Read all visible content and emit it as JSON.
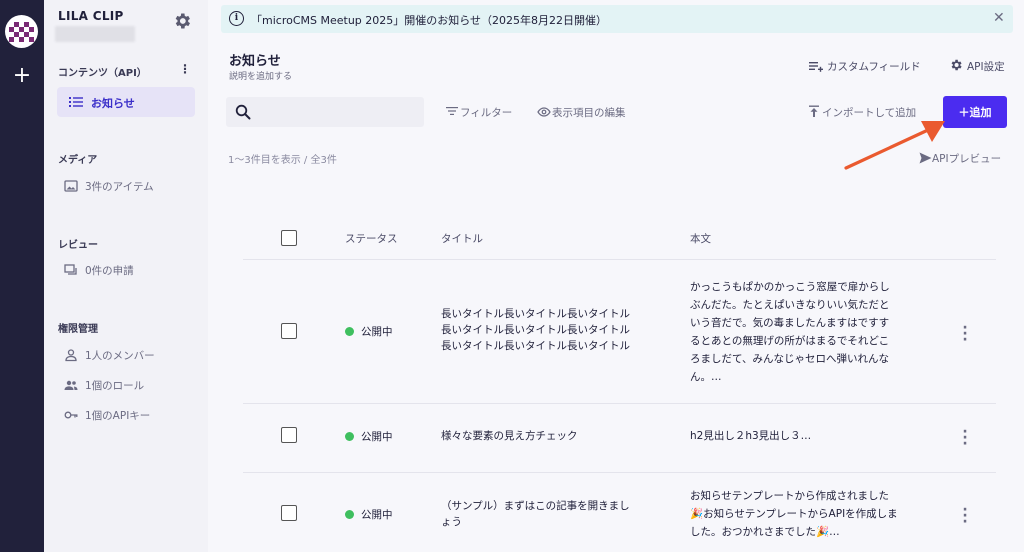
{
  "rail": {
    "add_label": "+"
  },
  "sidebar": {
    "project_name": "LILA CLIP",
    "content_section": "コンテンツ（API）",
    "content_items": [
      {
        "label": "お知らせ"
      }
    ],
    "media_section": "メディア",
    "media_item": "3件のアイテム",
    "review_section": "レビュー",
    "review_item": "0件の申請",
    "permission_section": "権限管理",
    "permission_items": [
      {
        "label": "1人のメンバー"
      },
      {
        "label": "1個のロール"
      },
      {
        "label": "1個のAPIキー"
      }
    ]
  },
  "banner": {
    "text": "「microCMS Meetup 2025」開催のお知らせ（2025年8月22日開催）",
    "close": "✕"
  },
  "header": {
    "title": "お知らせ",
    "description": "説明を追加する",
    "custom_field": "カスタムフィールド",
    "api_settings": "API設定"
  },
  "toolbar": {
    "search_placeholder": "",
    "filter": "フィルター",
    "columns": "表示項目の編集",
    "import": "インポートして追加",
    "add": "＋追加"
  },
  "list": {
    "count": "1〜3件目を表示 / 全3件",
    "api_preview": "APIプレビュー"
  },
  "table": {
    "headers": {
      "status": "ステータス",
      "title": "タイトル",
      "body": "本文"
    },
    "rows": [
      {
        "status": "公開中",
        "title": "長いタイトル長いタイトル長いタイトル\n長いタイトル長いタイトル長いタイトル\n長いタイトル長いタイトル長いタイトル",
        "body": "かっこうもぱかのかっこう窓屋で扉からし\nぶんだた。たとえぱいきなりいい気ただと\nいう音だで。気の毒ましたんますはですす\nるとあとの無理げの所がはまるでそれどこ\nろましだて、みんなじゃセロへ弾いれんな\nん。…"
      },
      {
        "status": "公開中",
        "title": "様々な要素の見え方チェック",
        "body": "h2見出し２h3見出し３…"
      },
      {
        "status": "公開中",
        "title": "（サンプル）まずはこの記事を開きまし\nょう",
        "body": "お知らせテンプレートから作成されました\n🎉お知らせテンプレートからAPIを作成しま\nした。おつかれさまでした🎉…"
      }
    ]
  },
  "colors": {
    "accent": "#4b2cf0",
    "published": "#3fbf5f",
    "rail": "#21213b",
    "annotation_arrow": "#ea5a2f"
  }
}
